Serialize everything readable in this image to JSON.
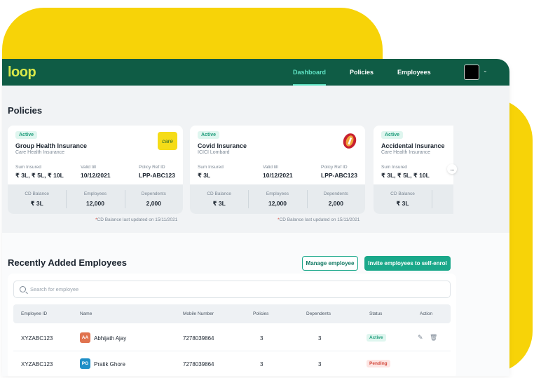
{
  "brand": {
    "logo": "loop"
  },
  "nav": {
    "links": [
      {
        "label": "Dashboard",
        "active": true
      },
      {
        "label": "Policies",
        "active": false
      },
      {
        "label": "Employees",
        "active": false
      }
    ],
    "dropdown_icon": "chevron-down-icon"
  },
  "policies": {
    "title": "Policies",
    "cards": [
      {
        "status": "Active",
        "name": "Group Health Insurance",
        "insurer": "Care Health Insurance",
        "logo_text": "care",
        "sum_insured_label": "Sum Insured",
        "sum_insured": "₹ 3L, ₹ 5L, ₹ 10L",
        "valid_label": "Valid till",
        "valid": "10/12/2021",
        "ref_label": "Policy Ref ID",
        "ref": "LPP-ABC123",
        "cd_label": "CD Balance",
        "cd": "₹ 3L",
        "emp_label": "Employees",
        "emp": "12,000",
        "dep_label": "Dependents",
        "dep": "2,000"
      },
      {
        "status": "Active",
        "name": "Covid Insurance",
        "insurer": "ICICI Lombard",
        "logo_text": "",
        "sum_insured_label": "Sum Insured",
        "sum_insured": "₹ 3L",
        "valid_label": "Valid till",
        "valid": "10/12/2021",
        "ref_label": "Policy Ref ID",
        "ref": "LPP-ABC123",
        "cd_label": "CD Balance",
        "cd": "₹ 3L",
        "emp_label": "Employees",
        "emp": "12,000",
        "dep_label": "Dependents",
        "dep": "2,000"
      },
      {
        "status": "Active",
        "name": "Accidental Insurance",
        "insurer": "Care Health Insurance",
        "sum_insured_label": "Sum Insured",
        "sum_insured": "₹ 3L, ₹ 5L, ₹ 10L",
        "cd_label": "CD Balance",
        "cd": "₹ 3L"
      }
    ],
    "cd_note_prefix": "*",
    "cd_note": "CD Balance last updated on 15/11/2021"
  },
  "employees": {
    "title": "Recently Added Employees",
    "manage_label": "Manage employee",
    "invite_label": "Invite employees to self-enrol",
    "search_placeholder": "Search for employee",
    "columns": [
      "Employee ID",
      "Name",
      "Mobile Number",
      "Policies",
      "Dependents",
      "Status",
      "Action"
    ],
    "rows": [
      {
        "id": "XYZABC123",
        "initials": "AA",
        "name": "Abhijath Ajay",
        "mobile": "7278039864",
        "policies": "3",
        "dependents": "3",
        "status": "Active"
      },
      {
        "id": "XYZABC123",
        "initials": "PG",
        "name": "Pratik Ghore",
        "mobile": "7278039864",
        "policies": "3",
        "dependents": "3",
        "status": "Pending"
      }
    ]
  },
  "colors": {
    "nav_bg": "#0f5c45",
    "accent": "#1aa88a",
    "yellow": "#f7d308",
    "active_status": "#1e9c7a",
    "pending_status": "#d2473a",
    "avatar_aa": "#e0734f",
    "avatar_pg": "#1f8fc7"
  }
}
